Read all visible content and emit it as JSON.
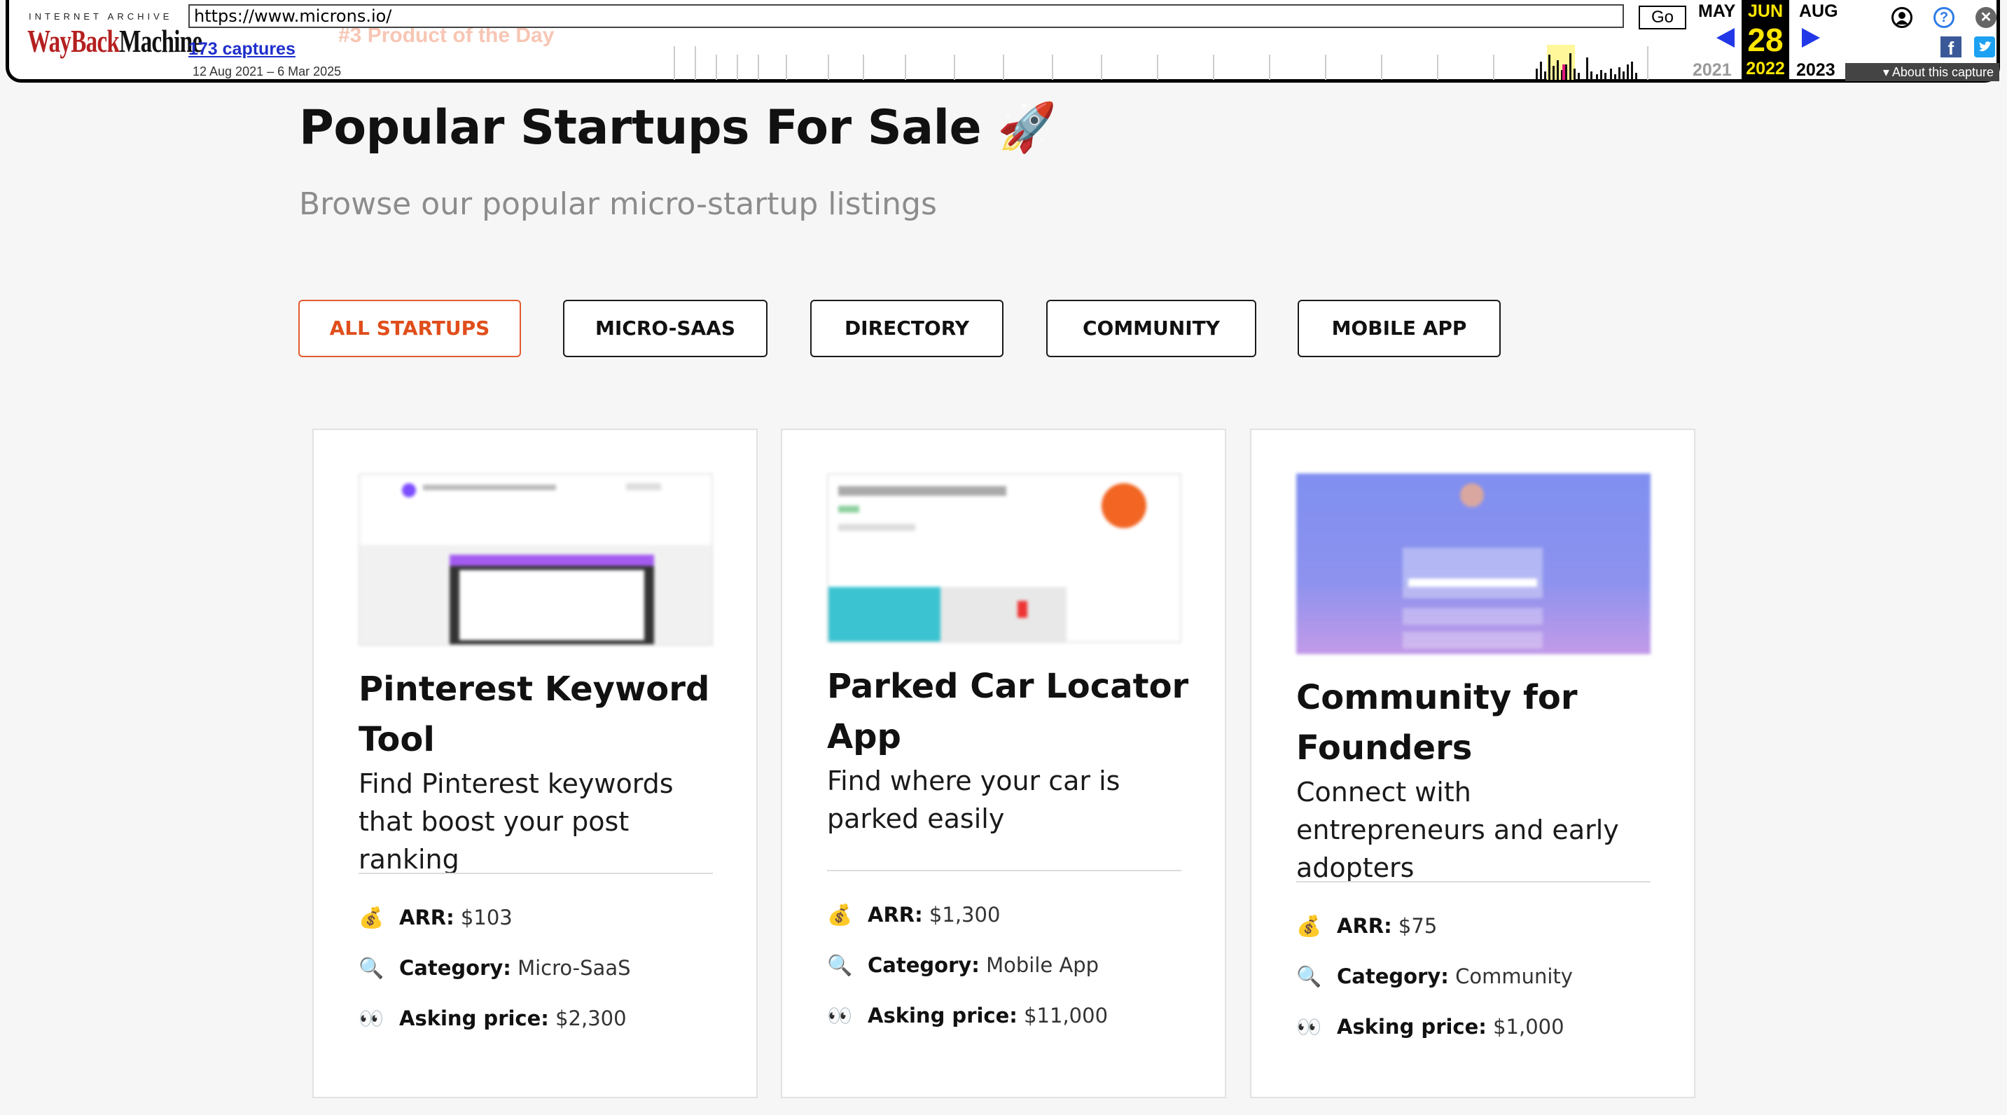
{
  "wayback": {
    "ia_label": "INTERNET ARCHIVE",
    "logo_wayback": "WayBack",
    "logo_machine": "Machine",
    "url": "https://www.microns.io/",
    "go": "Go",
    "captures": "173 captures",
    "range": "12 Aug 2021 – 6 Mar 2025",
    "ghost_text": "#3 Product of the Day",
    "prev_month": "MAY",
    "cur_month": "JUN",
    "next_month": "AUG",
    "cur_day": "28",
    "prev_year": "2021",
    "cur_year": "2022",
    "next_year": "2023",
    "about": "About this capture"
  },
  "page": {
    "title": "Popular Startups For Sale",
    "title_emoji": "🚀",
    "subtitle": "Browse our popular micro-startup listings"
  },
  "filters": [
    "ALL STARTUPS",
    "MICRO-SAAS",
    "DIRECTORY",
    "COMMUNITY",
    "MOBILE APP"
  ],
  "active_filter": "ALL STARTUPS",
  "labels": {
    "arr": "ARR:",
    "category": "Category:",
    "asking": "Asking price:"
  },
  "icons": {
    "arr": "💰",
    "category": "🔍",
    "asking": "👀"
  },
  "cards": [
    {
      "title": "Pinterest Keyword Tool",
      "desc": "Find Pinterest keywords that boost your post ranking",
      "arr": "$103",
      "category": "Micro-SaaS",
      "asking": "$2,300"
    },
    {
      "title": "Parked Car Locator App",
      "desc": "Find where your car is parked easily",
      "arr": "$1,300",
      "category": "Mobile App",
      "asking": "$11,000"
    },
    {
      "title": "Community for Founders",
      "desc": "Connect with entrepreneurs and early adopters",
      "arr": "$75",
      "category": "Community",
      "asking": "$1,000"
    }
  ],
  "colors": {
    "accent": "#e04e1b",
    "wayback_red": "#b52020",
    "wayback_year": "#ffe600"
  }
}
